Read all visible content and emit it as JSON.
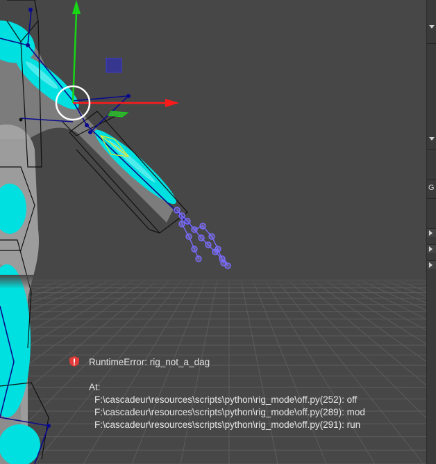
{
  "error": {
    "title": "RuntimeError: rig_not_a_dag",
    "at_label": "At:",
    "trace": [
      "F:\\cascadeur\\resources\\scripts\\python\\rig_mode\\off.py(252): off",
      "F:\\cascadeur\\resources\\scripts\\python\\rig_mode\\off.py(289): mod",
      "F:\\cascadeur\\resources\\scripts\\python\\rig_mode\\off.py(291): run"
    ],
    "icon": "error-shield-icon"
  },
  "gizmo": {
    "x_axis_color": "#ff1a1a",
    "y_axis_color": "#16d616",
    "z_plane_color": "#2b2bbf"
  },
  "colors": {
    "viewport_bg": "#474747",
    "grid_line": "#5a5a5a",
    "body_cyan": "#00e5e5",
    "rig_blue": "#0a0a8c",
    "error_red": "#e03a3a"
  },
  "panel": {
    "letter": "G"
  }
}
